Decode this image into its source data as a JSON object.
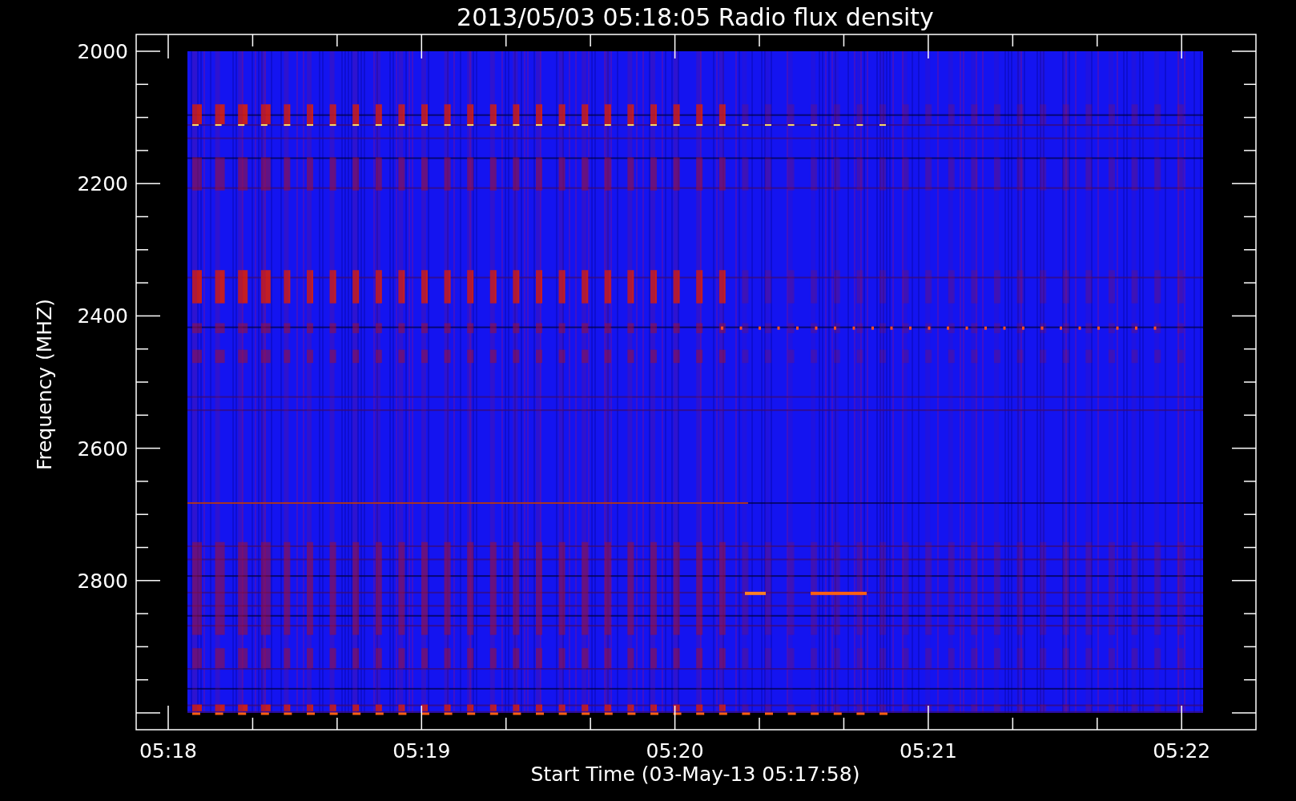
{
  "title": "2013/05/03 05:18:05 Radio flux density",
  "ylabel": "Frequency (MHZ)",
  "xlabel": "Start Time (03-May-13 05:17:58)",
  "yticks": [
    "2000",
    "2200",
    "2400",
    "2600",
    "2800"
  ],
  "xticks": [
    "05:18",
    "05:19",
    "05:20",
    "05:21",
    "05:22"
  ]
}
